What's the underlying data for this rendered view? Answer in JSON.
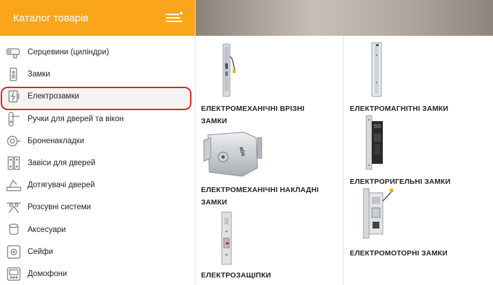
{
  "sidebar": {
    "title": "Каталог товарів",
    "items": [
      {
        "label": "Серцевини (циліндри)",
        "icon": "cylinder-icon"
      },
      {
        "label": "Замки",
        "icon": "lock-icon"
      },
      {
        "label": "Електрозамки",
        "icon": "electric-lock-icon",
        "active": true
      },
      {
        "label": "Ручки для дверей та вікон",
        "icon": "door-handle-icon"
      },
      {
        "label": "Броненакладки",
        "icon": "armor-plate-icon"
      },
      {
        "label": "Завіси для дверей",
        "icon": "hinge-icon"
      },
      {
        "label": "Дотягувачі дверей",
        "icon": "door-closer-icon"
      },
      {
        "label": "Розсувні системи",
        "icon": "sliding-system-icon"
      },
      {
        "label": "Аксесуари",
        "icon": "accessories-icon"
      },
      {
        "label": "Сейфи",
        "icon": "safe-icon"
      },
      {
        "label": "Домофони",
        "icon": "intercom-icon"
      }
    ]
  },
  "colors": {
    "accent": "#fba51a",
    "highlight": "#d9261c"
  },
  "subcategories": {
    "left": [
      {
        "label_line1": "ЕЛЕКТРОМЕХАНІЧНІ ВРІЗНІ",
        "label_line2": "ЗАМКИ"
      },
      {
        "label_line1": "ЕЛЕКТРОМЕХАНІЧНІ НАКЛАДНІ",
        "label_line2": "ЗАМКИ"
      },
      {
        "label_line1": "ЕЛЕКТРОЗАЩІПКИ"
      }
    ],
    "right": [
      {
        "label": "ЕЛЕКТРОМАГНІТНІ ЗАМКИ"
      },
      {
        "label": "ЕЛЕКТРОРИГЕЛЬНІ ЗАМКИ"
      },
      {
        "label": "ЕЛЕКТРОМОТОРНІ ЗАМКИ"
      }
    ],
    "brand_text": "atis"
  }
}
